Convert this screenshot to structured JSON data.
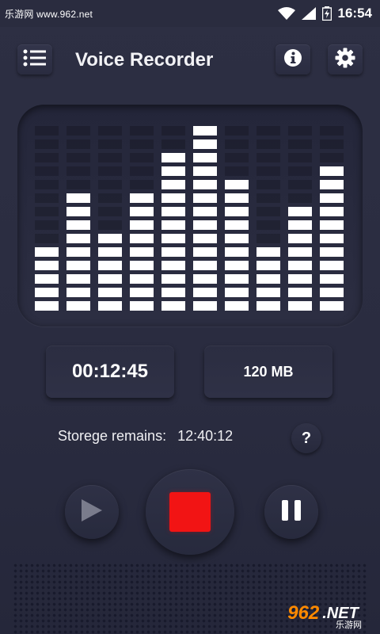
{
  "status_bar": {
    "left_text": "乐游网 www.962.net",
    "time": "16:54",
    "icons": [
      "wifi-icon",
      "signal-icon",
      "battery-icon"
    ]
  },
  "toolbar": {
    "title": "Voice Recorder",
    "menu_icon": "list-menu-icon",
    "info_icon": "info-icon",
    "settings_icon": "gear-icon"
  },
  "equalizer": {
    "levels": [
      5,
      9,
      6,
      9,
      12,
      14,
      10,
      5,
      8,
      11
    ],
    "max_segments": 14,
    "color": "#ffffff"
  },
  "recording": {
    "elapsed": "00:12:45",
    "file_size": "120 MB"
  },
  "storage": {
    "label": "Storege remains:",
    "value": "12:40:12",
    "help": "?"
  },
  "controls": {
    "play_icon": "play-icon",
    "stop_icon": "stop-icon",
    "pause_icon": "pause-icon",
    "stop_color": "#f21414"
  },
  "watermark": {
    "number": "962",
    "suffix": ".NET",
    "cn": "乐游网"
  }
}
